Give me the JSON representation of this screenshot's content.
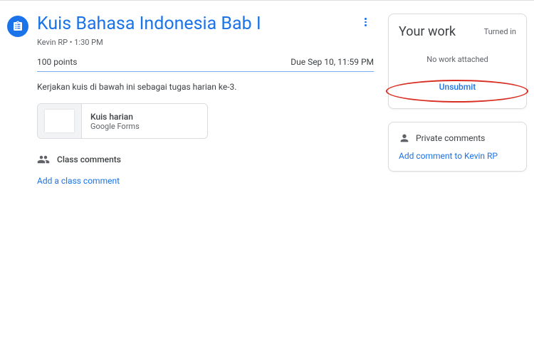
{
  "main": {
    "title": "Kuis Bahasa Indonesia Bab I",
    "author": "Kevin RP",
    "time": "1:30 PM",
    "points": "100 points",
    "due": "Due Sep 10, 11:59 PM",
    "description": "Kerjakan kuis di bawah ini sebagai tugas harian ke-3.",
    "attachment": {
      "title": "Kuis harian",
      "subtitle": "Google Forms"
    },
    "class_comments_label": "Class comments",
    "add_class_comment": "Add a class comment"
  },
  "side": {
    "your_work": "Your work",
    "status": "Turned in",
    "no_attached": "No work attached",
    "unsubmit": "Unsubmit",
    "private_comments": "Private comments",
    "add_private": "Add comment to Kevin RP"
  }
}
